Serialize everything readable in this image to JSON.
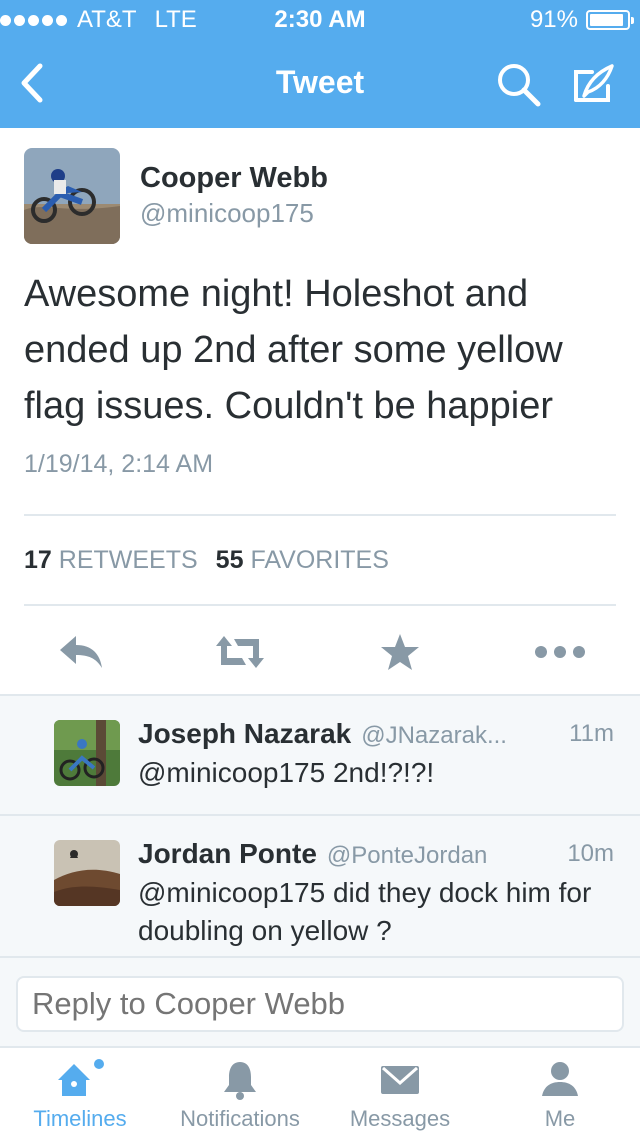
{
  "status_bar": {
    "carrier": "AT&T",
    "network": "LTE",
    "time": "2:30 AM",
    "battery": "91%",
    "battery_level": 0.91
  },
  "nav": {
    "title": "Tweet",
    "back_icon": "chevron-left-icon",
    "search_icon": "search-icon",
    "compose_icon": "compose-icon"
  },
  "tweet": {
    "author_name": "Cooper Webb",
    "author_handle": "@minicoop175",
    "text": "Awesome night! Holeshot and ended up 2nd after some yellow flag issues. Couldn't be happier",
    "timestamp": "1/19/14, 2:14 AM",
    "retweet_count": "17",
    "retweet_label": "RETWEETS",
    "favorite_count": "55",
    "favorite_label": "FAVORITES"
  },
  "actions": {
    "reply_icon": "reply-icon",
    "retweet_icon": "retweet-icon",
    "favorite_icon": "star-icon",
    "more_icon": "more-icon"
  },
  "replies": [
    {
      "name": "Joseph Nazarak",
      "handle": "@JNazarak...",
      "time": "11m",
      "text": "@minicoop175 2nd!?!?!"
    },
    {
      "name": "Jordan Ponte",
      "handle": "@PonteJordan",
      "time": "10m",
      "text": "@minicoop175 did they dock him for doubling on yellow ?"
    }
  ],
  "reply_box": {
    "placeholder": "Reply to Cooper Webb"
  },
  "tabs": [
    {
      "label": "Timelines",
      "icon": "home-icon",
      "active": true
    },
    {
      "label": "Notifications",
      "icon": "bell-icon",
      "active": false
    },
    {
      "label": "Messages",
      "icon": "envelope-icon",
      "active": false
    },
    {
      "label": "Me",
      "icon": "person-icon",
      "active": false
    }
  ],
  "colors": {
    "brand": "#55acee",
    "text": "#292f33",
    "muted": "#8899a6",
    "border": "#e1e8ed"
  }
}
